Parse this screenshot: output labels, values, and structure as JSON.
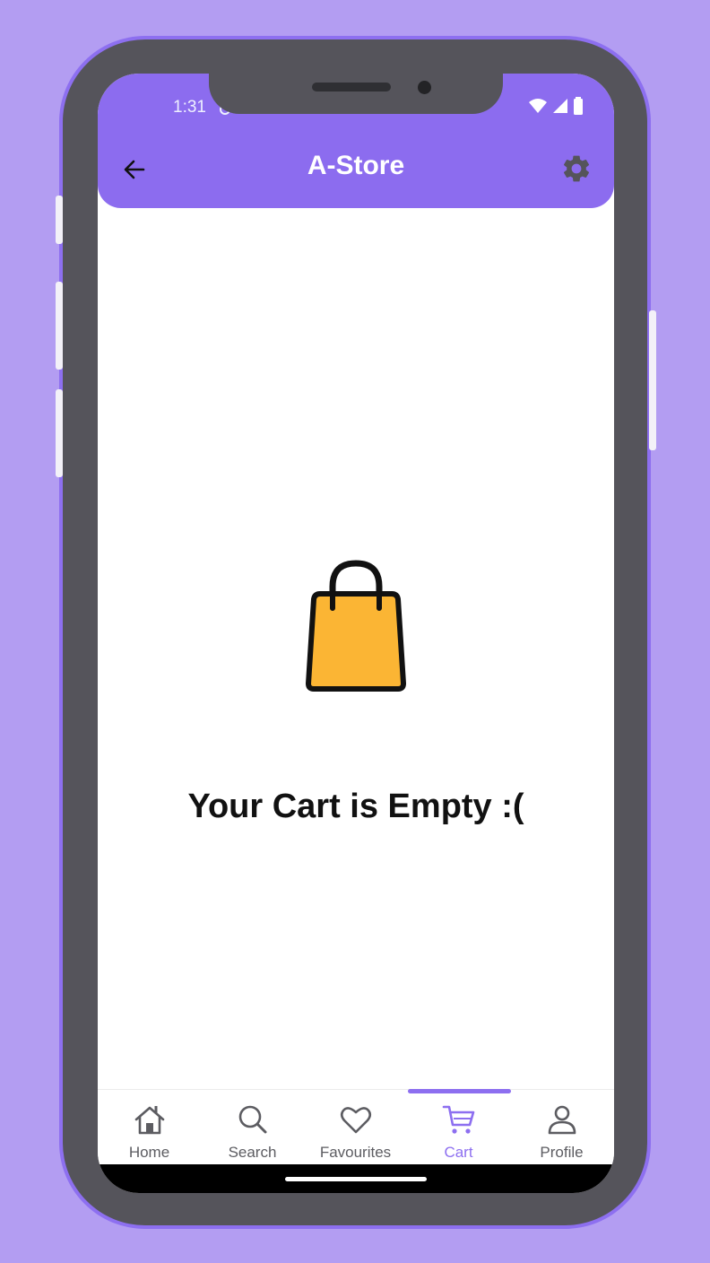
{
  "status_bar": {
    "time": "1:31"
  },
  "app_bar": {
    "title": "A-Store",
    "back_icon": "arrow-left-icon",
    "settings_icon": "gear-icon"
  },
  "empty_state": {
    "icon": "shopping-bag-icon",
    "message": "Your Cart is Empty :("
  },
  "bottom_nav": {
    "items": [
      {
        "label": "Home",
        "icon": "home-icon"
      },
      {
        "label": "Search",
        "icon": "search-icon"
      },
      {
        "label": "Favourites",
        "icon": "heart-icon"
      },
      {
        "label": "Cart",
        "icon": "cart-icon"
      },
      {
        "label": "Profile",
        "icon": "profile-icon"
      }
    ],
    "active": "Cart"
  },
  "colors": {
    "background": "#b39df2",
    "accent": "#8d6ff0",
    "app_bar": "#8c6cef",
    "frame": "#55545b",
    "bag_fill": "#fbb534"
  }
}
